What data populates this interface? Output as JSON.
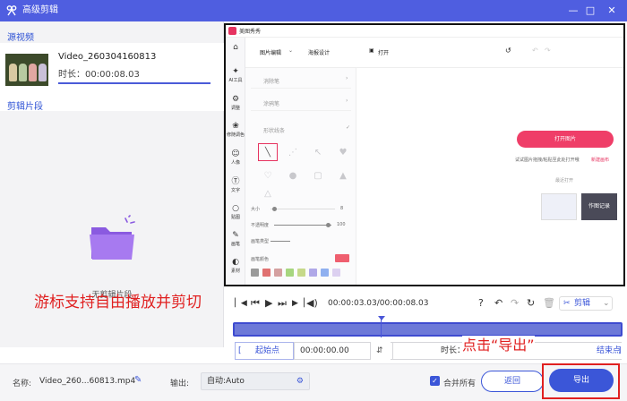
{
  "window": {
    "title": "高级剪辑",
    "min": "—",
    "max": "□",
    "close": "✕"
  },
  "left": {
    "source_title": "源视频",
    "video_name": "Video_260304160813",
    "video_duration": "时长：00:00:08.03",
    "clips_title": "剪辑片段",
    "empty_text": "无剪辑片段"
  },
  "app": {
    "name": "美图秀秀",
    "rail": [
      "AI工具",
      "调整",
      "修随调色",
      "人像",
      "文字",
      "贴图",
      "画笔",
      "素材"
    ],
    "tab_image_edit": "图片编辑",
    "tab_poster": "海报设计",
    "open_menu": "打开",
    "panel_rows": [
      "消除笔",
      "涂鸦笔",
      "形状线条"
    ],
    "size_label": "大小",
    "size_val": "8",
    "opacity_label": "不透明度",
    "opacity_val": "100",
    "brush_type_label": "画笔类型",
    "brush_color_label": "画笔颜色",
    "swatch_colors": [
      "#9a9a9a",
      "#e07070",
      "#d4a0a0",
      "#a7d67f",
      "#c6d98a",
      "#b0a8e8",
      "#8fb0f0",
      "#dcd0f0"
    ],
    "open_image_btn": "打开图片",
    "drop_hint": "试试图片拖拽/粘贴至此处打开哦",
    "new_canvas": "新建画布",
    "recent_open": "最近打开",
    "recent_thumb_text": "作图记录"
  },
  "annotation_left": "游标支持自由播放并剪切",
  "controls": {
    "time": "00:00:03.03/00:00:08.03",
    "cut_label": "剪辑"
  },
  "trim": {
    "start_label": "起始点",
    "start_value": "00:00:00.00",
    "duration": "时长：00:00:08.03",
    "end_label": "结束点"
  },
  "annotation_right": "点击“导出”",
  "bottom": {
    "name_label": "名称:",
    "name_value": "Video_260...60813.mp4",
    "output_label": "输出:",
    "format_value": "自动:Auto",
    "merge_label": "合并所有",
    "back_label": "返回",
    "export_label": "导出"
  },
  "colors": {
    "accent": "#3b56d8",
    "title_bar": "#4f5ee0",
    "annotation": "#e02020",
    "open_btn": "#ef3e68"
  }
}
